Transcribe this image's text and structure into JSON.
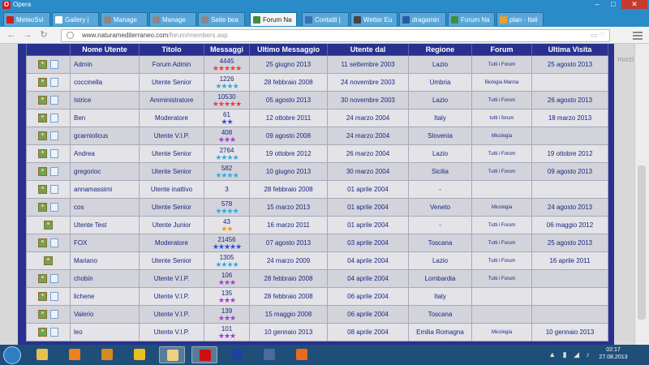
{
  "window": {
    "app_name": "Opera"
  },
  "tabs": [
    {
      "label": "MeteoSvi",
      "color": "#d21e1e"
    },
    {
      "label": "Gallery |",
      "color": "#ffffff"
    },
    {
      "label": "Manage",
      "color": "#888888"
    },
    {
      "label": "Manage",
      "color": "#888888"
    },
    {
      "label": "Seite bea",
      "color": "#888888"
    },
    {
      "label": "Forum Na",
      "color": "#3e8e3e",
      "active": true
    },
    {
      "label": "Contatti |",
      "color": "#3a6fb5"
    },
    {
      "label": "Wetter Eu",
      "color": "#444444"
    },
    {
      "label": "dragamin",
      "color": "#2b5aa5"
    },
    {
      "label": "Forum Na",
      "color": "#3e8e3e"
    },
    {
      "label": "plan - Itali",
      "color": "#e8a030"
    }
  ],
  "address_bar": {
    "url_host": "www.naturamediterraneo.com",
    "url_path": "/forum/members.asp",
    "side_text": "mozilla"
  },
  "table": {
    "headers": [
      "",
      "Nome Utente",
      "Titolo",
      "Messaggi",
      "Ultimo Messaggio",
      "Utente dal",
      "Regione",
      "Forum",
      "Ultima Visita"
    ],
    "rows": [
      {
        "name": "Admin",
        "title": "Forum Admin",
        "msgs": "4445",
        "stars": "★★★★★",
        "star_color": "#e8403a",
        "last": "25 giugno 2013",
        "since": "11 settembre 2003",
        "region": "Lazio",
        "forum": "Tutti i Forum",
        "visit": "25 agosto 2013",
        "icons": 2
      },
      {
        "name": "coccinella",
        "title": "Utente Senior",
        "msgs": "1226",
        "stars": "★★★★",
        "star_color": "#33aadd",
        "last": "28 febbraio 2008",
        "since": "24 novembre 2003",
        "region": "Umbria",
        "forum": "Biologia Marina",
        "visit": "",
        "icons": 2
      },
      {
        "name": "Istrice",
        "title": "Amministratore",
        "msgs": "10530",
        "stars": "★★★★★",
        "star_color": "#e8403a",
        "last": "05 agosto 2013",
        "since": "30 novembre 2003",
        "region": "Lazio",
        "forum": "Tutti i Forum",
        "visit": "26 agosto 2013",
        "icons": 2
      },
      {
        "name": "Ben",
        "title": "Moderatore",
        "msgs": "61",
        "stars": "★★",
        "star_color": "#2c50d8",
        "last": "12 ottobre 2011",
        "since": "24 marzo 2004",
        "region": "Italy",
        "forum": "tutti i forum",
        "visit": "18 marzo 2013",
        "icons": 2
      },
      {
        "name": "gcarniolicus",
        "title": "Utente V.I.P.",
        "msgs": "408",
        "stars": "★★★",
        "star_color": "#a33ad8",
        "last": "09 agosto 2008",
        "since": "24 marzo 2004",
        "region": "Slovenia",
        "forum": "Micologia",
        "visit": "",
        "icons": 2
      },
      {
        "name": "Andrea",
        "title": "Utente Senior",
        "msgs": "2764",
        "stars": "★★★★",
        "star_color": "#33aadd",
        "last": "19 ottobre 2012",
        "since": "26 marzo 2004",
        "region": "Lazio",
        "forum": "Tutti i Forum",
        "visit": "19 ottobre 2012",
        "icons": 2
      },
      {
        "name": "gregorioc",
        "title": "Utente Senior",
        "msgs": "582",
        "stars": "★★★★",
        "star_color": "#33aadd",
        "last": "10 giugno 2013",
        "since": "30 marzo 2004",
        "region": "Sicilia",
        "forum": "Tutti i Forum",
        "visit": "09 agosto 2013",
        "icons": 2
      },
      {
        "name": "annamassimi",
        "title": "Utente inattivo",
        "msgs": "3",
        "stars": "",
        "star_color": "#33aadd",
        "last": "28 febbraio 2008",
        "since": "01 aprile 2004",
        "region": "-",
        "forum": "",
        "visit": "",
        "icons": 2
      },
      {
        "name": "cos",
        "title": "Utente Senior",
        "msgs": "578",
        "stars": "★★★★",
        "star_color": "#33aadd",
        "last": "15 marzo 2013",
        "since": "01 aprile 2004",
        "region": "Veneto",
        "forum": "Micologia",
        "visit": "24 agosto 2013",
        "icons": 2
      },
      {
        "name": "Utente Test",
        "title": "Utente Junior",
        "msgs": "43",
        "stars": "★★",
        "star_color": "#e8a020",
        "last": "16 marzo 2011",
        "since": "01 aprile 2004",
        "region": "-",
        "forum": "Tutti i Forum",
        "visit": "06 maggio 2012",
        "icons": 1
      },
      {
        "name": "FOX",
        "title": "Moderatore",
        "msgs": "21456",
        "stars": "★★★★★",
        "star_color": "#2c50d8",
        "last": "07 agosto 2013",
        "since": "03 aprile 2004",
        "region": "Toscana",
        "forum": "Tutti i Forum",
        "visit": "25 agosto 2013",
        "icons": 2
      },
      {
        "name": "Mariano",
        "title": "Utente Senior",
        "msgs": "1305",
        "stars": "★★★★",
        "star_color": "#33aadd",
        "last": "24 marzo 2009",
        "since": "04 aprile 2004",
        "region": "Lazio",
        "forum": "Tutti i Forum",
        "visit": "16 aprile 2011",
        "icons": 1
      },
      {
        "name": "chobin",
        "title": "Utente V.I.P.",
        "msgs": "106",
        "stars": "★★★",
        "star_color": "#a33ad8",
        "last": "28 febbraio 2008",
        "since": "04 aprile 2004",
        "region": "Lombardia",
        "forum": "Tutti i Forum",
        "visit": "",
        "icons": 2
      },
      {
        "name": "lichene",
        "title": "Utente V.I.P.",
        "msgs": "135",
        "stars": "★★★",
        "star_color": "#a33ad8",
        "last": "28 febbraio 2008",
        "since": "06 aprile 2004",
        "region": "Italy",
        "forum": "",
        "visit": "",
        "icons": 2
      },
      {
        "name": "Valerio",
        "title": "Utente V.I.P.",
        "msgs": "139",
        "stars": "★★★",
        "star_color": "#a33ad8",
        "last": "15 maggio 2008",
        "since": "06 aprile 2004",
        "region": "Toscana",
        "forum": "",
        "visit": "",
        "icons": 2
      },
      {
        "name": "leo",
        "title": "Utente V.I.P.",
        "msgs": "101",
        "stars": "★★★",
        "star_color": "#a33ad8",
        "last": "10 gennaio 2013",
        "since": "08 aprile 2004",
        "region": "Emilia Romagna",
        "forum": "Micologia",
        "visit": "10 gennaio 2013",
        "icons": 2
      }
    ]
  },
  "taskbar": {
    "items": [
      {
        "icon": "folder-icon",
        "color": "#e8c050"
      },
      {
        "icon": "vlc-icon",
        "color": "#f08020"
      },
      {
        "icon": "winamp-icon",
        "color": "#d88a20"
      },
      {
        "icon": "warning-app-icon",
        "color": "#e8c020"
      },
      {
        "icon": "notes-icon",
        "color": "#f0d080",
        "active": true
      },
      {
        "icon": "opera-icon",
        "color": "#d01010",
        "active": true
      },
      {
        "icon": "ice-app-icon",
        "color": "#2040a0"
      },
      {
        "icon": "camera-app-icon",
        "color": "#4a6aa0"
      },
      {
        "icon": "firefox-icon",
        "color": "#e86a20"
      }
    ],
    "clock_time": "02:17",
    "clock_date": "27.08.2013"
  }
}
